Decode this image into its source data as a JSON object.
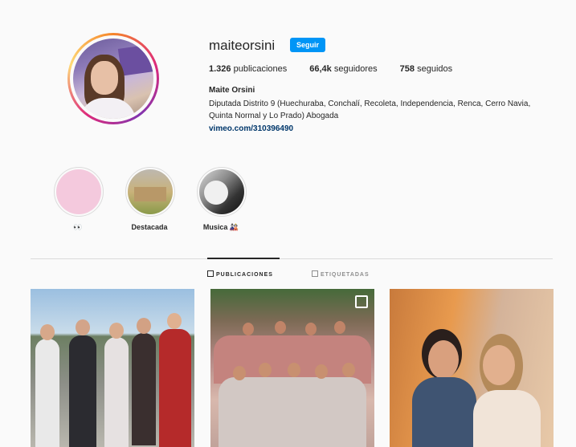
{
  "profile": {
    "username": "maiteorsini",
    "follow_label": "Seguir",
    "stats": {
      "posts_value": "1.326",
      "posts_label": "publicaciones",
      "followers_value": "66,4k",
      "followers_label": "seguidores",
      "following_value": "758",
      "following_label": "seguidos"
    },
    "full_name": "Maite Orsini",
    "bio": "Diputada Distrito 9 (Huechuraba, Conchalí, Recoleta, Independencia, Renca, Cerro Navia, Quinta Normal y Lo Prado) Abogada",
    "link": "vimeo.com/310396490"
  },
  "highlights": [
    {
      "label": "👀",
      "icon": "pink-note-thumbnail"
    },
    {
      "label": "Destacada",
      "icon": "building-thumbnail"
    },
    {
      "label": "Musica 🎎",
      "icon": "bw-photo-thumbnail"
    }
  ],
  "tabs": [
    {
      "label": "Publicaciones",
      "icon": "grid-icon",
      "active": true
    },
    {
      "label": "Etiquetadas",
      "icon": "tag-icon",
      "active": false
    }
  ],
  "colors": {
    "accent": "#0095f6",
    "link": "#00376b",
    "text": "#262626",
    "muted": "#8e8e8e"
  }
}
